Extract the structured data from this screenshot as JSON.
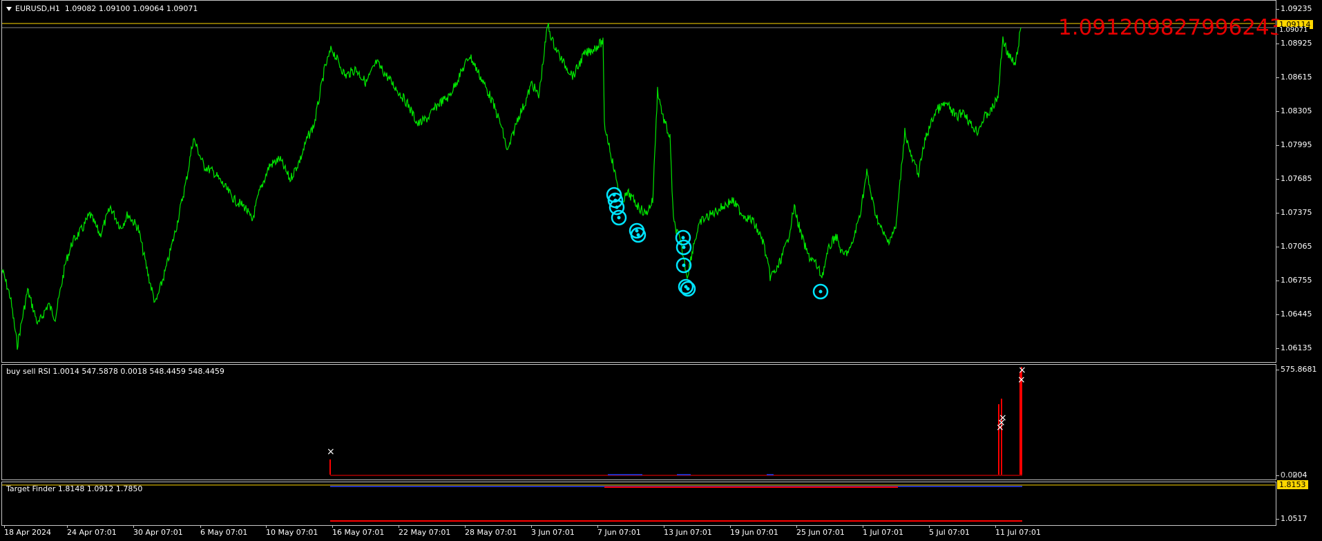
{
  "main": {
    "symbol": "EURUSD,H1",
    "ohlc": "1.09082 1.09100 1.09064 1.09071",
    "big_price": "1.091209827996243",
    "current_price": "1.09071",
    "line_price": "1.09114",
    "price_ticks": [
      "1.09235",
      "1.08925",
      "1.08615",
      "1.08305",
      "1.07995",
      "1.07685",
      "1.07375",
      "1.07065",
      "1.06755",
      "1.06445",
      "1.06135"
    ]
  },
  "rsi_pane": {
    "label": "buy sell RSI 1.0014 547.5878 0.0018 548.4459 548.4459",
    "ticks": [
      "575.8681",
      "0.0204"
    ],
    "extra_tick": "0.00"
  },
  "tf_pane": {
    "label": "Target Finder 1.8148 1.0912 1.7850",
    "badge": "1.8153",
    "tick": "1.0517"
  },
  "time_axis": [
    "18 Apr 2024",
    "24 Apr 07:01",
    "30 Apr 07:01",
    "6 May 07:01",
    "10 May 07:01",
    "16 May 07:01",
    "22 May 07:01",
    "28 May 07:01",
    "3 Jun 07:01",
    "7 Jun 07:01",
    "13 Jun 07:01",
    "19 Jun 07:01",
    "25 Jun 07:01",
    "1 Jul 07:01",
    "5 Jul 07:01",
    "11 Jul 07:01"
  ],
  "colors": {
    "price_line": "#00e600",
    "marker": "#00e5ff",
    "rsi_bar": "#ff0000",
    "badge": "#ffd700",
    "big_price": "#e60000"
  }
}
